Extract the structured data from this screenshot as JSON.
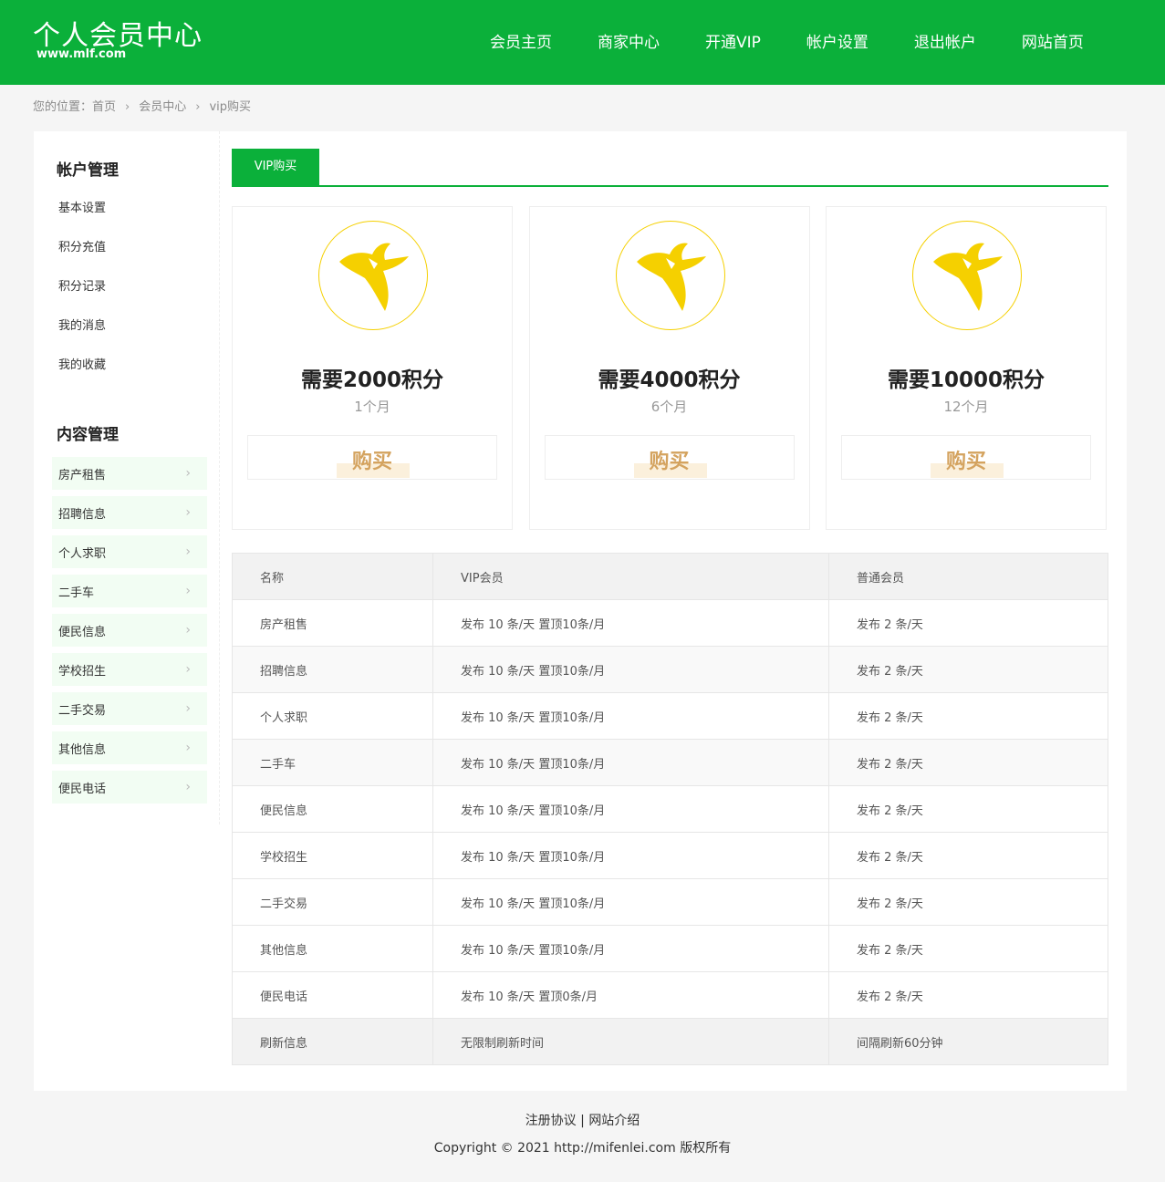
{
  "header": {
    "title": "个人会员中心",
    "subtitle": "www.mlf.com",
    "nav": [
      "会员主页",
      "商家中心",
      "开通VIP",
      "帐户设置",
      "退出帐户",
      "网站首页"
    ]
  },
  "breadcrumb": {
    "prefix": "您的位置：",
    "items": [
      "首页",
      "会员中心",
      "vip购买"
    ],
    "separator": "›"
  },
  "sidebar": {
    "group1_title": "帐户管理",
    "group1_items": [
      "基本设置",
      "积分充值",
      "积分记录",
      "我的消息",
      "我的收藏"
    ],
    "group2_title": "内容管理",
    "group2_items": [
      "房产租售",
      "招聘信息",
      "个人求职",
      "二手车",
      "便民信息",
      "学校招生",
      "二手交易",
      "其他信息",
      "便民电话"
    ],
    "chevron": "›"
  },
  "tab": {
    "label": "VIP购买"
  },
  "cards": [
    {
      "title": "需要2000积分",
      "duration": "1个月",
      "button": "购买"
    },
    {
      "title": "需要4000积分",
      "duration": "6个月",
      "button": "购买"
    },
    {
      "title": "需要10000积分",
      "duration": "12个月",
      "button": "购买"
    }
  ],
  "table": {
    "headers": [
      "名称",
      "VIP会员",
      "普通会员"
    ],
    "rows": [
      [
        "房产租售",
        "发布 10 条/天 置顶10条/月",
        "发布 2 条/天"
      ],
      [
        "招聘信息",
        "发布 10 条/天 置顶10条/月",
        "发布 2 条/天"
      ],
      [
        "个人求职",
        "发布 10 条/天 置顶10条/月",
        "发布 2 条/天"
      ],
      [
        "二手车",
        "发布 10 条/天 置顶10条/月",
        "发布 2 条/天"
      ],
      [
        "便民信息",
        "发布 10 条/天 置顶10条/月",
        "发布 2 条/天"
      ],
      [
        "学校招生",
        "发布 10 条/天 置顶10条/月",
        "发布 2 条/天"
      ],
      [
        "二手交易",
        "发布 10 条/天 置顶10条/月",
        "发布 2 条/天"
      ],
      [
        "其他信息",
        "发布 10 条/天 置顶10条/月",
        "发布 2 条/天"
      ],
      [
        "便民电话",
        "发布 10 条/天 置顶0条/月",
        "发布 2 条/天"
      ],
      [
        "刷新信息",
        "无限制刷新时间",
        "间隔刷新60分钟"
      ]
    ]
  },
  "footer": {
    "links": [
      "注册协议",
      "网站介绍"
    ],
    "divider": "|",
    "copyright": "Copyright © 2021 http://mifenlei.com 版权所有"
  },
  "colors": {
    "brand": "#0bb03a",
    "gold": "#f5d000",
    "buy": "#d4a35f"
  },
  "icons": {
    "vip_badge": "vip-v-icon",
    "chevron": "chevron-right-icon"
  }
}
